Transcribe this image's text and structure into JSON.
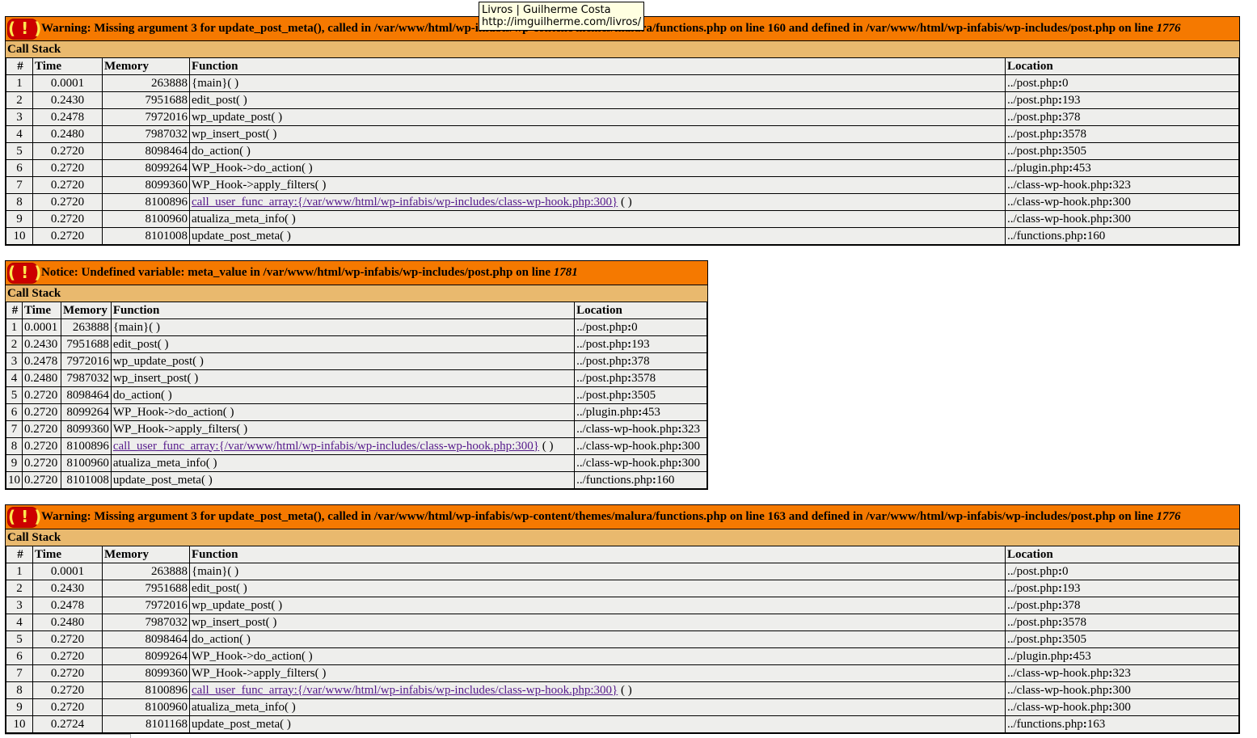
{
  "tooltip": {
    "title": "Livros | Guilherme Costa",
    "url": "http://imguilherme.com/livros/"
  },
  "columns": {
    "num": "#",
    "time": "Time",
    "memory": "Memory",
    "function": "Function",
    "location": "Location"
  },
  "errors": [
    {
      "icon": "( ! )",
      "message": "Warning: Missing argument 3 for update_post_meta(), called in /var/www/html/wp-infabis/wp-content/themes/malura/functions.php on line 160 and defined in /var/www/html/wp-infabis/wp-includes/post.php on line ",
      "line": "1776",
      "call_stack_label": "Call Stack",
      "rows": [
        {
          "n": "1",
          "time": "0.0001",
          "mem": "263888",
          "fn": "{main}( )",
          "link": "",
          "loc_file": "../post.php",
          "loc_line": "0"
        },
        {
          "n": "2",
          "time": "0.2430",
          "mem": "7951688",
          "fn": "edit_post( )",
          "link": "",
          "loc_file": "../post.php",
          "loc_line": "193"
        },
        {
          "n": "3",
          "time": "0.2478",
          "mem": "7972016",
          "fn": "wp_update_post( )",
          "link": "",
          "loc_file": "../post.php",
          "loc_line": "378"
        },
        {
          "n": "4",
          "time": "0.2480",
          "mem": "7987032",
          "fn": "wp_insert_post( )",
          "link": "",
          "loc_file": "../post.php",
          "loc_line": "3578"
        },
        {
          "n": "5",
          "time": "0.2720",
          "mem": "8098464",
          "fn": "do_action( )",
          "link": "",
          "loc_file": "../post.php",
          "loc_line": "3505"
        },
        {
          "n": "6",
          "time": "0.2720",
          "mem": "8099264",
          "fn": "WP_Hook->do_action( )",
          "link": "",
          "loc_file": "../plugin.php",
          "loc_line": "453"
        },
        {
          "n": "7",
          "time": "0.2720",
          "mem": "8099360",
          "fn": "WP_Hook->apply_filters( )",
          "link": "",
          "loc_file": "../class-wp-hook.php",
          "loc_line": "323"
        },
        {
          "n": "8",
          "time": "0.2720",
          "mem": "8100896",
          "fn": " ( )",
          "link": "call_user_func_array:{/var/www/html/wp-infabis/wp-includes/class-wp-hook.php:300}",
          "loc_file": "../class-wp-hook.php",
          "loc_line": "300"
        },
        {
          "n": "9",
          "time": "0.2720",
          "mem": "8100960",
          "fn": "atualiza_meta_info( )",
          "link": "",
          "loc_file": "../class-wp-hook.php",
          "loc_line": "300"
        },
        {
          "n": "10",
          "time": "0.2720",
          "mem": "8101008",
          "fn": "update_post_meta( )",
          "link": "",
          "loc_file": "../functions.php",
          "loc_line": "160"
        }
      ]
    },
    {
      "icon": "( ! )",
      "message": "Notice: Undefined variable: meta_value in /var/www/html/wp-infabis/wp-includes/post.php on line ",
      "line": "1781",
      "call_stack_label": "Call Stack",
      "rows": [
        {
          "n": "1",
          "time": "0.0001",
          "mem": "263888",
          "fn": "{main}( )",
          "link": "",
          "loc_file": "../post.php",
          "loc_line": "0"
        },
        {
          "n": "2",
          "time": "0.2430",
          "mem": "7951688",
          "fn": "edit_post( )",
          "link": "",
          "loc_file": "../post.php",
          "loc_line": "193"
        },
        {
          "n": "3",
          "time": "0.2478",
          "mem": "7972016",
          "fn": "wp_update_post( )",
          "link": "",
          "loc_file": "../post.php",
          "loc_line": "378"
        },
        {
          "n": "4",
          "time": "0.2480",
          "mem": "7987032",
          "fn": "wp_insert_post( )",
          "link": "",
          "loc_file": "../post.php",
          "loc_line": "3578"
        },
        {
          "n": "5",
          "time": "0.2720",
          "mem": "8098464",
          "fn": "do_action( )",
          "link": "",
          "loc_file": "../post.php",
          "loc_line": "3505"
        },
        {
          "n": "6",
          "time": "0.2720",
          "mem": "8099264",
          "fn": "WP_Hook->do_action( )",
          "link": "",
          "loc_file": "../plugin.php",
          "loc_line": "453"
        },
        {
          "n": "7",
          "time": "0.2720",
          "mem": "8099360",
          "fn": "WP_Hook->apply_filters( )",
          "link": "",
          "loc_file": "../class-wp-hook.php",
          "loc_line": "323"
        },
        {
          "n": "8",
          "time": "0.2720",
          "mem": "8100896",
          "fn": " ( )",
          "link": "call_user_func_array:{/var/www/html/wp-infabis/wp-includes/class-wp-hook.php:300}",
          "loc_file": "../class-wp-hook.php",
          "loc_line": "300"
        },
        {
          "n": "9",
          "time": "0.2720",
          "mem": "8100960",
          "fn": "atualiza_meta_info( )",
          "link": "",
          "loc_file": "../class-wp-hook.php",
          "loc_line": "300"
        },
        {
          "n": "10",
          "time": "0.2720",
          "mem": "8101008",
          "fn": "update_post_meta( )",
          "link": "",
          "loc_file": "../functions.php",
          "loc_line": "160"
        }
      ]
    },
    {
      "icon": "( ! )",
      "message": "Warning: Missing argument 3 for update_post_meta(), called in /var/www/html/wp-infabis/wp-content/themes/malura/functions.php on line 163 and defined in /var/www/html/wp-infabis/wp-includes/post.php on line ",
      "line": "1776",
      "call_stack_label": "Call Stack",
      "rows": [
        {
          "n": "1",
          "time": "0.0001",
          "mem": "263888",
          "fn": "{main}( )",
          "link": "",
          "loc_file": "../post.php",
          "loc_line": "0"
        },
        {
          "n": "2",
          "time": "0.2430",
          "mem": "7951688",
          "fn": "edit_post( )",
          "link": "",
          "loc_file": "../post.php",
          "loc_line": "193"
        },
        {
          "n": "3",
          "time": "0.2478",
          "mem": "7972016",
          "fn": "wp_update_post( )",
          "link": "",
          "loc_file": "../post.php",
          "loc_line": "378"
        },
        {
          "n": "4",
          "time": "0.2480",
          "mem": "7987032",
          "fn": "wp_insert_post( )",
          "link": "",
          "loc_file": "../post.php",
          "loc_line": "3578"
        },
        {
          "n": "5",
          "time": "0.2720",
          "mem": "8098464",
          "fn": "do_action( )",
          "link": "",
          "loc_file": "../post.php",
          "loc_line": "3505"
        },
        {
          "n": "6",
          "time": "0.2720",
          "mem": "8099264",
          "fn": "WP_Hook->do_action( )",
          "link": "",
          "loc_file": "../plugin.php",
          "loc_line": "453"
        },
        {
          "n": "7",
          "time": "0.2720",
          "mem": "8099360",
          "fn": "WP_Hook->apply_filters( )",
          "link": "",
          "loc_file": "../class-wp-hook.php",
          "loc_line": "323"
        },
        {
          "n": "8",
          "time": "0.2720",
          "mem": "8100896",
          "fn": " ( )",
          "link": "call_user_func_array:{/var/www/html/wp-infabis/wp-includes/class-wp-hook.php:300}",
          "loc_file": "../class-wp-hook.php",
          "loc_line": "300"
        },
        {
          "n": "9",
          "time": "0.2720",
          "mem": "8100960",
          "fn": "atualiza_meta_info( )",
          "link": "",
          "loc_file": "../class-wp-hook.php",
          "loc_line": "300"
        },
        {
          "n": "10",
          "time": "0.2724",
          "mem": "8101168",
          "fn": "update_post_meta( )",
          "link": "",
          "loc_file": "../functions.php",
          "loc_line": "163"
        }
      ]
    }
  ],
  "colors": {
    "header_bg": "#f57900",
    "callstack_bg": "#e9b96e",
    "row_bg": "#eeeeec",
    "icon_bg": "#cc0000",
    "icon_fg": "#fce94f",
    "link": "#551a8b"
  }
}
